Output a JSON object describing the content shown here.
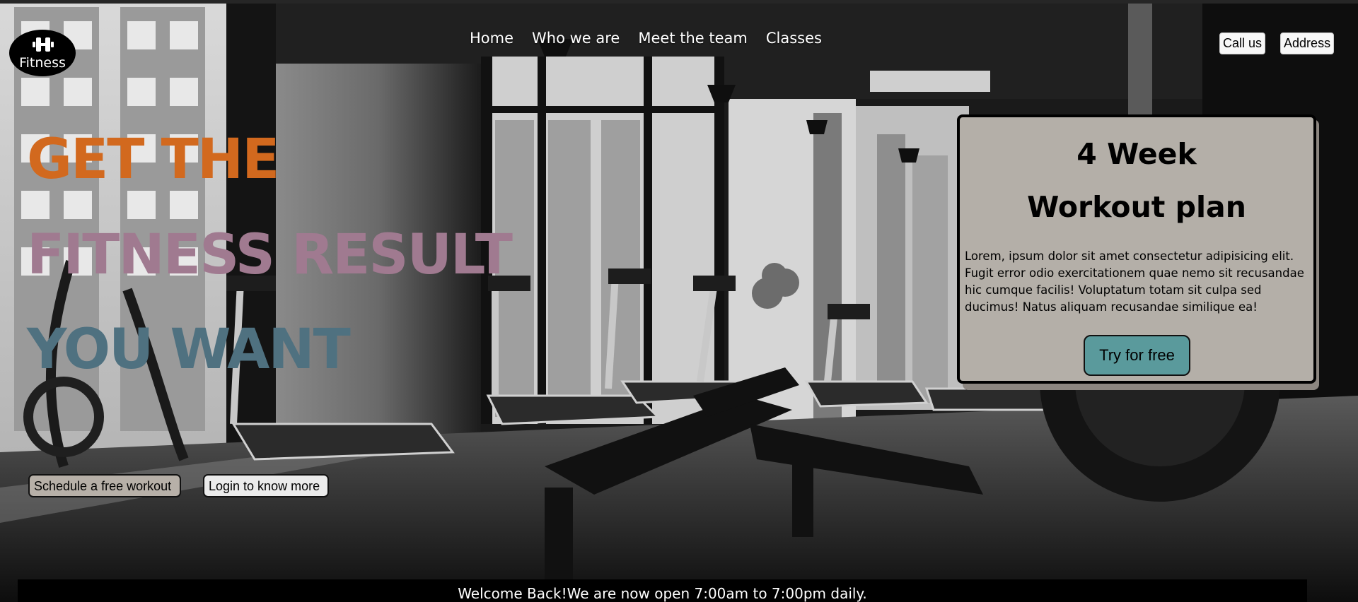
{
  "brand": {
    "logo_text": "Fitness",
    "logo_icon": "dumbbell-icon"
  },
  "nav": {
    "items": [
      {
        "label": "Home"
      },
      {
        "label": "Who we are"
      },
      {
        "label": "Meet the team"
      },
      {
        "label": "Classes"
      }
    ]
  },
  "top_actions": {
    "call_label": "Call us",
    "address_label": "Address"
  },
  "hero": {
    "line1": "GET THE",
    "line2": "FITNESS RESULT",
    "line3": "YOU WANT",
    "line1_color": "#d2691e",
    "line2_color": "#a07a90",
    "line3_color": "#4f7180",
    "schedule_label": "Schedule a free workout",
    "login_label": "Login to know more"
  },
  "card": {
    "title_line1": "4 Week",
    "title_line2": "Workout plan",
    "body": "Lorem, ipsum dolor sit amet consectetur adipisicing elit. Fugit error odio exercitationem quae nemo sit recusandae hic cumque facilis! Voluptatum totam sit culpa sed ducimus! Natus aliquam recusandae similique ea!",
    "cta_label": "Try for free",
    "background": "#b4afa8",
    "cta_color": "#5a9a9c"
  },
  "footer": {
    "message": "Welcome Back!We are now open 7:00am to 7:00pm daily."
  }
}
